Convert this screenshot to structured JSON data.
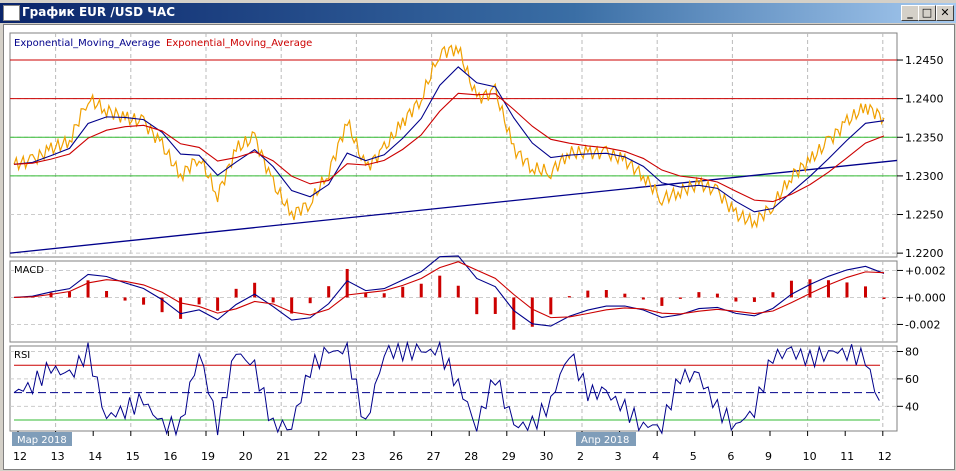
{
  "window": {
    "title": "График EUR /USD  ЧАС",
    "minimize": "_",
    "maximize": "□",
    "close": "✕"
  },
  "legend": {
    "ema_fast": "Exponential_Moving_Average",
    "ema_slow": "Exponential_Moving_Average"
  },
  "colors": {
    "price": "#f0a000",
    "ema_fast": "#00008b",
    "ema_slow": "#cc0000",
    "resistance": "#cc0000",
    "support": "#33bb33",
    "trend": "#00008b"
  },
  "chart_data": {
    "type": "line",
    "title": "График EUR /USD  ЧАС",
    "x_labels": [
      "12",
      "13",
      "14",
      "15",
      "16",
      "19",
      "20",
      "21",
      "22",
      "23",
      "26",
      "27",
      "28",
      "29",
      "30",
      "2",
      "3",
      "4",
      "5",
      "6",
      "9",
      "10",
      "11",
      "12"
    ],
    "month_labels": [
      {
        "label": "Мар 2018",
        "at": "12"
      },
      {
        "label": "Апр 2018",
        "at": "2"
      }
    ],
    "price": {
      "ylim": [
        1.2195,
        1.2485
      ],
      "ticks": [
        "1.2450",
        "1.2400",
        "1.2350",
        "1.2300",
        "1.2250",
        "1.2200"
      ],
      "values": [
        1.2315,
        1.232,
        1.2335,
        1.2345,
        1.24,
        1.2385,
        1.2375,
        1.237,
        1.234,
        1.23,
        1.2325,
        1.2275,
        1.2335,
        1.235,
        1.229,
        1.225,
        1.2265,
        1.2305,
        1.237,
        1.231,
        1.2335,
        1.237,
        1.24,
        1.246,
        1.2465,
        1.24,
        1.241,
        1.2335,
        1.231,
        1.2305,
        1.233,
        1.233,
        1.233,
        1.232,
        1.23,
        1.227,
        1.228,
        1.229,
        1.228,
        1.225,
        1.224,
        1.2262,
        1.23,
        1.232,
        1.2345,
        1.237,
        1.239,
        1.2375
      ],
      "horizontal_lines": [
        {
          "value": 1.245,
          "kind": "resistance"
        },
        {
          "value": 1.24,
          "kind": "resistance"
        },
        {
          "value": 1.235,
          "kind": "support"
        },
        {
          "value": 1.23,
          "kind": "support"
        }
      ],
      "trendline": [
        1.22,
        1.232
      ]
    },
    "macd": {
      "label": "MACD",
      "ylim": [
        -0.0033,
        0.0027
      ],
      "ticks": [
        "+0.002",
        "+0.000",
        "-0.002"
      ]
    },
    "rsi": {
      "label": "RSI",
      "ylim": [
        22,
        84
      ],
      "ticks": [
        "80",
        "60",
        "40"
      ],
      "levels": [
        70,
        50,
        30
      ]
    }
  }
}
